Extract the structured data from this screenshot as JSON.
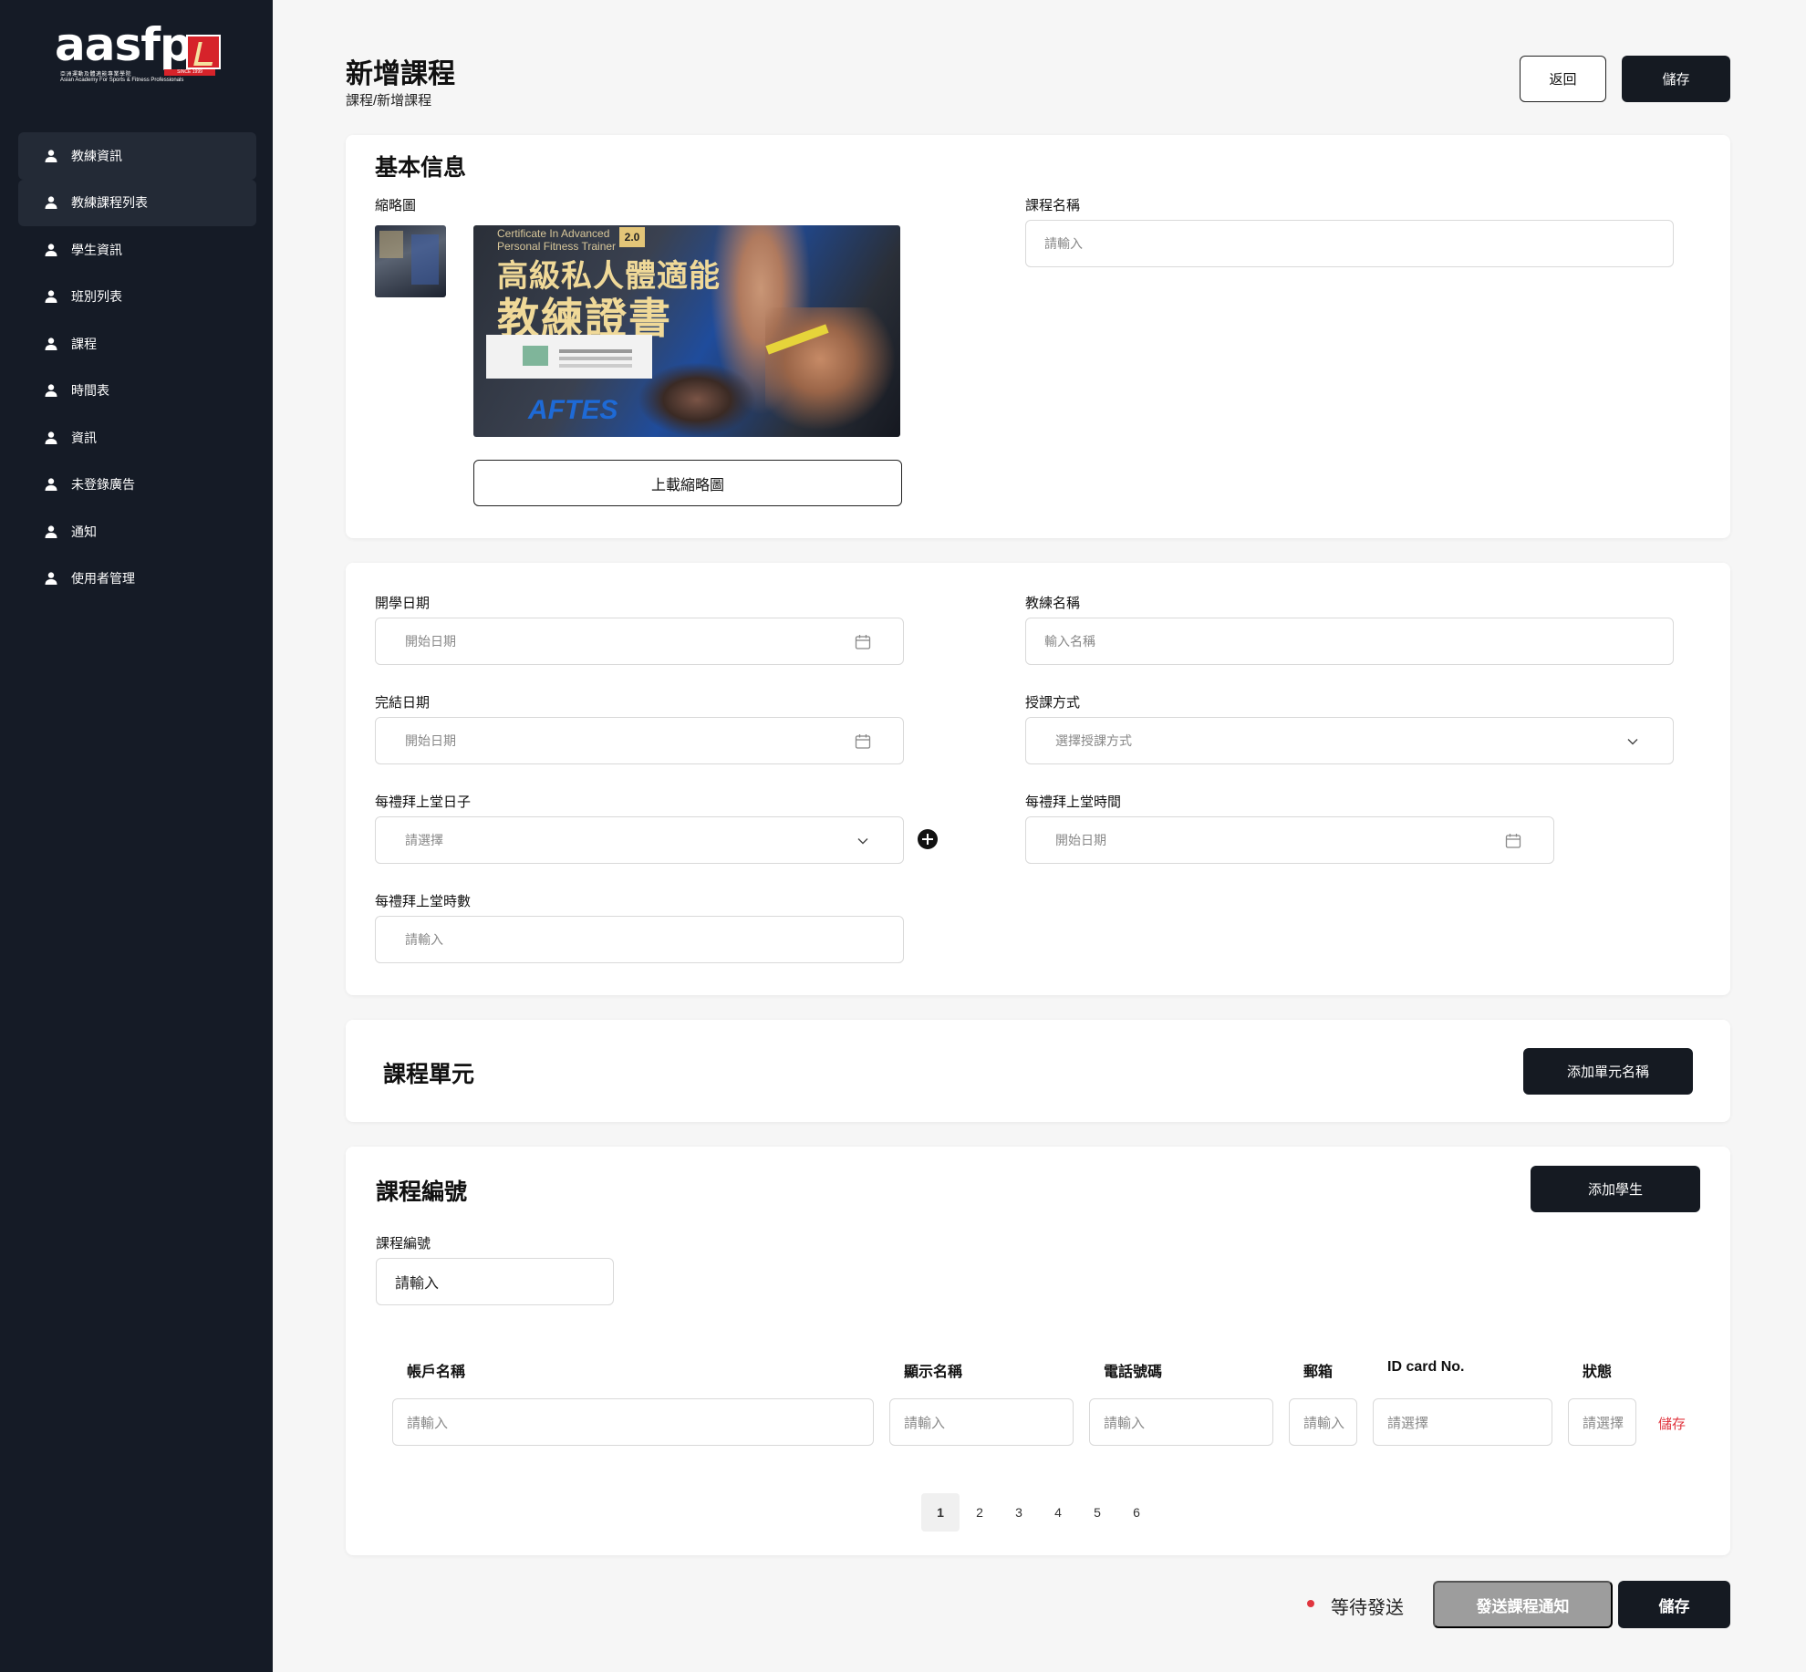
{
  "brand": {
    "logo_text": "aasfp",
    "logo_line1": "亞洲運動及體適能專業學院",
    "logo_line2": "Asian Academy For Sports & Fitness Professionals",
    "logo_since": "SINCE 1999",
    "sidebar_bg": "#151b26",
    "accent_red": "#e0353e"
  },
  "sidebar": {
    "items": [
      {
        "label": "教練資訊",
        "icon": "user-icon"
      },
      {
        "label": "教練課程列表",
        "icon": "user-icon"
      },
      {
        "label": "學生資訊",
        "icon": "user-icon"
      },
      {
        "label": "班別列表",
        "icon": "user-icon"
      },
      {
        "label": "課程",
        "icon": "user-icon"
      },
      {
        "label": "時間表",
        "icon": "user-icon"
      },
      {
        "label": "資訊",
        "icon": "user-icon"
      },
      {
        "label": "未登錄廣告",
        "icon": "user-icon"
      },
      {
        "label": "通知",
        "icon": "user-icon"
      },
      {
        "label": "使用者管理",
        "icon": "user-icon"
      }
    ]
  },
  "header": {
    "title": "新增課程",
    "breadcrumb": "課程/新增課程",
    "back_label": "返回",
    "save_label": "儲存"
  },
  "basic": {
    "title": "基本信息",
    "thumbnail_label": "縮略圖",
    "thumbnail_text": {
      "line1": "Certificate In Advanced",
      "line2": "Personal Fitness Trainer",
      "badge": "2.0",
      "title1": "高級私人體適能",
      "title2": "教練證書",
      "brand": "AFTES"
    },
    "upload_label": "上載縮略圖",
    "course_name_label": "課程名稱",
    "course_name_placeholder": "請輸入"
  },
  "schedule": {
    "start_label": "開學日期",
    "start_placeholder": "開始日期",
    "end_label": "完結日期",
    "end_placeholder": "開始日期",
    "weekday_label": "每禮拜上堂日子",
    "weekday_placeholder": "請選擇",
    "hours_label": "每禮拜上堂時數",
    "hours_placeholder": "請輸入",
    "coach_label": "教練名稱",
    "coach_placeholder": "輸入名稱",
    "method_label": "授課方式",
    "method_placeholder": "選擇授課方式",
    "time_label": "每禮拜上堂時間",
    "time_placeholder": "開始日期"
  },
  "units": {
    "title": "課程單元",
    "add_label": "添加單元名稱"
  },
  "code": {
    "title": "課程編號",
    "add_student_label": "添加學生",
    "code_label": "課程編號",
    "code_placeholder": "請輸入",
    "columns": [
      "帳戶名稱",
      "顯示名稱",
      "電話號碼",
      "郵箱",
      "ID card No.",
      "狀態"
    ],
    "row": [
      "請輸入",
      "請輸入",
      "請輸入",
      "請輸入",
      "請選擇",
      "請選擇"
    ],
    "row_save": "儲存",
    "pages": [
      "1",
      "2",
      "3",
      "4",
      "5",
      "6"
    ],
    "current_page": "1"
  },
  "footer": {
    "status": "等待發送",
    "send_label": "發送課程通知",
    "save_label": "儲存"
  }
}
